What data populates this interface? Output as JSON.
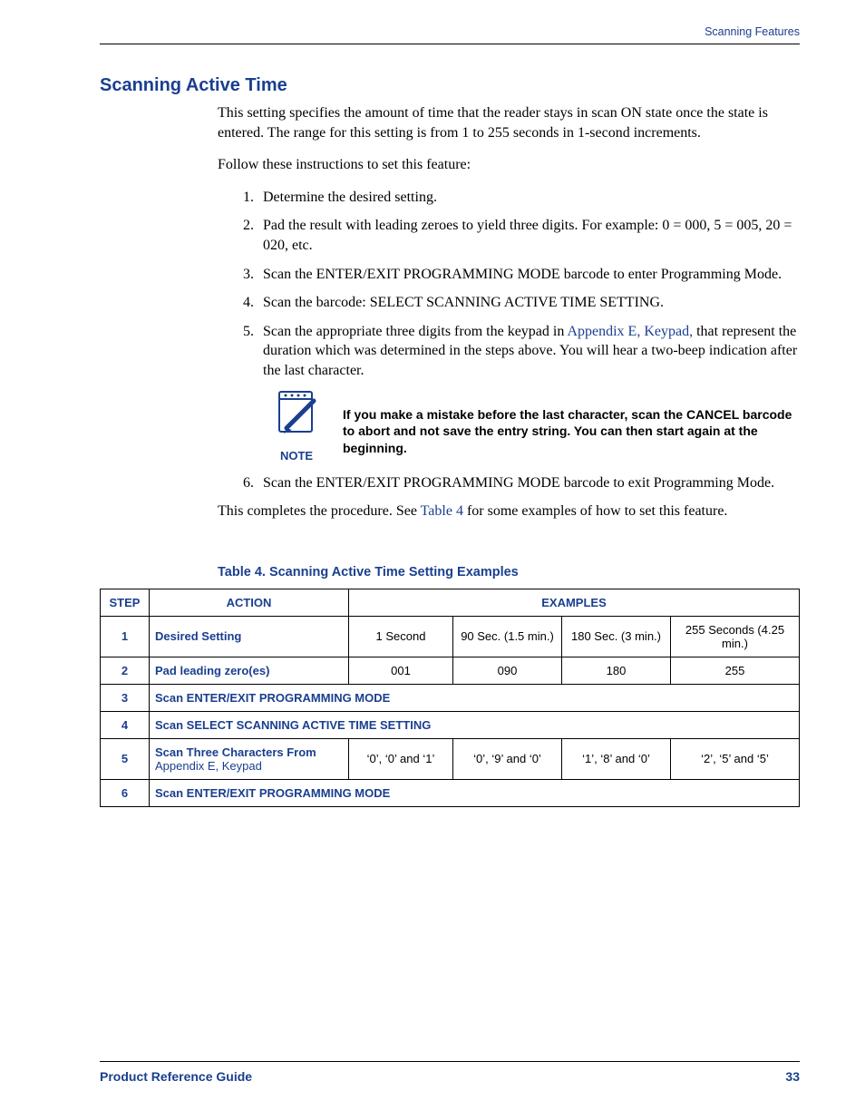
{
  "header": {
    "right": "Scanning Features"
  },
  "section_title": "Scanning Active Time",
  "intro1": "This setting specifies the amount of time that the reader stays in scan ON state once the state is entered. The range for this setting is from 1 to 255 seconds in 1-second increments.",
  "intro2": "Follow these instructions to set this feature:",
  "steps": {
    "s1": "Determine the desired setting.",
    "s2": "Pad the result with leading zeroes to yield three digits. For example: 0 = 000, 5 = 005, 20 = 020, etc.",
    "s3": "Scan the ENTER/EXIT PROGRAMMING MODE barcode to enter Programming Mode.",
    "s4": "Scan the barcode: SELECT SCANNING ACTIVE TIME SETTING.",
    "s5a": "Scan the appropriate three digits from the keypad in ",
    "s5_link": "Appendix E, Keypad,",
    "s5b": " that represent the duration which was determined in the steps above. You will hear a two-beep indication after the last character.",
    "s6": "Scan the ENTER/EXIT PROGRAMMING MODE barcode to exit Programming Mode."
  },
  "note": {
    "label": "NOTE",
    "text": "If you make a mistake before the last character, scan the CANCEL barcode to abort and not save the entry string. You can then start again at the beginning."
  },
  "closing_a": "This completes the procedure. See ",
  "closing_link": "Table 4",
  "closing_b": " for some examples of how to set this feature.",
  "table": {
    "caption": "Table 4. Scanning Active Time Setting Examples",
    "headers": {
      "step": "STEP",
      "action": "ACTION",
      "examples": "EXAMPLES"
    },
    "rows": {
      "r1": {
        "step": "1",
        "action": "Desired Setting",
        "c1": "1 Second",
        "c2": "90 Sec. (1.5 min.)",
        "c3": "180 Sec. (3 min.)",
        "c4": "255 Seconds (4.25 min.)"
      },
      "r2": {
        "step": "2",
        "action": "Pad leading zero(es)",
        "c1": "001",
        "c2": "090",
        "c3": "180",
        "c4": "255"
      },
      "r3": {
        "step": "3",
        "action": "Scan ENTER/EXIT PROGRAMMING MODE"
      },
      "r4": {
        "step": "4",
        "action": "Scan SELECT SCANNING ACTIVE TIME SETTING"
      },
      "r5": {
        "step": "5",
        "action_a": "Scan Three Characters From ",
        "action_link": "Appendix E, Keypad",
        "c1": "‘0’, ‘0’ and ‘1’",
        "c2": "‘0’, ‘9’ and ‘0’",
        "c3": "‘1’, ‘8’ and ‘0’",
        "c4": "‘2’, ‘5’ and ‘5’"
      },
      "r6": {
        "step": "6",
        "action": "Scan ENTER/EXIT PROGRAMMING MODE"
      }
    }
  },
  "footer": {
    "left": "Product Reference Guide",
    "right": "33"
  }
}
